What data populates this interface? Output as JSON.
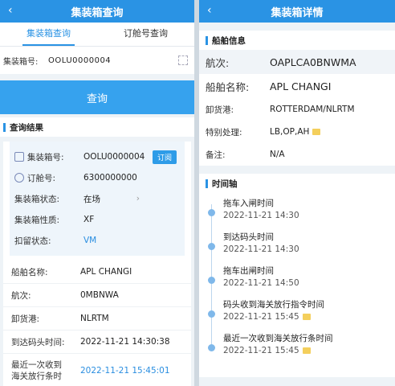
{
  "left": {
    "title": "集装箱查询",
    "tabs": [
      "集装箱查询",
      "订舱号查询"
    ],
    "search": {
      "label": "集装箱号:",
      "value": "OOLU0000004"
    },
    "query_button": "查询",
    "results_title": "查询结果",
    "subscribe_label": "订阅",
    "card_rows": [
      {
        "key": "集装箱号:",
        "value": "OOLU0000004"
      },
      {
        "key": "订舱号:",
        "value": "6300000000"
      },
      {
        "key": "集装箱状态:",
        "value": "在场"
      },
      {
        "key": "集装箱性质:",
        "value": "XF"
      },
      {
        "key": "扣留状态:",
        "value": "VM"
      }
    ],
    "plain_rows": [
      {
        "key": "船舶名称:",
        "value": "APL CHANGI"
      },
      {
        "key": "航次:",
        "value": "0MBNWA"
      },
      {
        "key": "卸货港:",
        "value": "NLRTM"
      },
      {
        "key": "到达码头时间:",
        "value": "2022-11-21 14:30:38"
      },
      {
        "key": "最近一次收到\n海关放行条时",
        "value": "2022-11-21 15:45:01"
      }
    ]
  },
  "right": {
    "title": "集装箱详情",
    "ship_section": "船舶信息",
    "ship_rows": [
      {
        "key": "航次:",
        "value": "OAPLCA0BNWMA"
      },
      {
        "key": "船舶名称:",
        "value": "APL CHANGI"
      },
      {
        "key": "卸货港:",
        "value": "ROTTERDAM/NLRTM"
      },
      {
        "key": "特别处理:",
        "value": "LB,OP,AH"
      },
      {
        "key": "备注:",
        "value": "N/A"
      }
    ],
    "timeline_section": "时间轴",
    "timeline": [
      {
        "event": "拖车入闸时间",
        "time": "2022-11-21 14:30"
      },
      {
        "event": "到达码头时间",
        "time": "2022-11-21 14:30"
      },
      {
        "event": "拖车出闸时间",
        "time": "2022-11-21 14:50"
      },
      {
        "event": "码头收到海关放行指令时间",
        "time": "2022-11-21 15:45"
      },
      {
        "event": "最近一次收到海关放行条时间",
        "time": "2022-11-21 15:45"
      }
    ]
  }
}
